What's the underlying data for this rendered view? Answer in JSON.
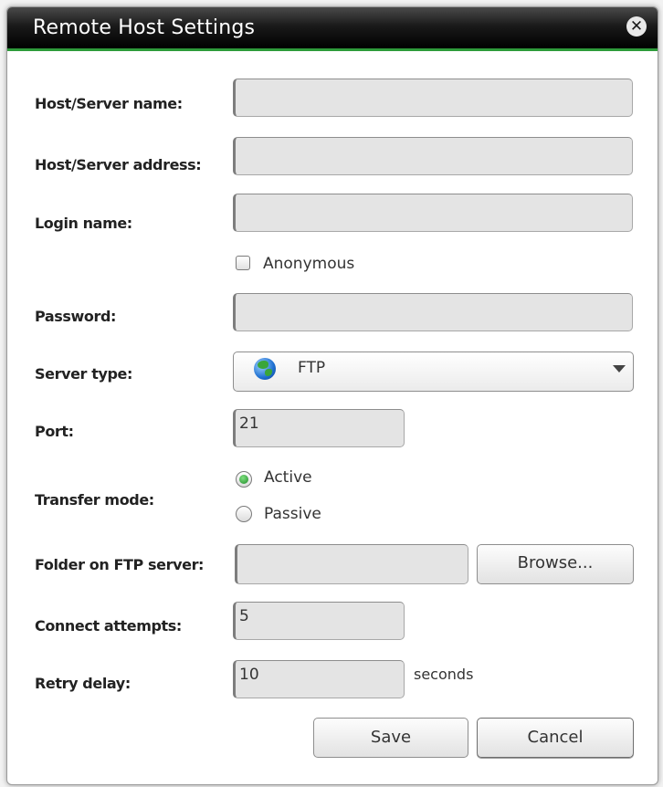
{
  "window": {
    "title": "Remote Host Settings",
    "close_icon": "close-icon"
  },
  "fields": {
    "host_name": {
      "label": "Host/Server name:",
      "value": ""
    },
    "host_address": {
      "label": "Host/Server address:",
      "value": ""
    },
    "login_name": {
      "label": "Login name:",
      "value": ""
    },
    "anonymous": {
      "label": "Anonymous",
      "checked": false
    },
    "password": {
      "label": "Password:",
      "value": ""
    },
    "server_type": {
      "label": "Server type:",
      "selected": "FTP",
      "icon": "globe-icon"
    },
    "port": {
      "label": "Port:",
      "value": "21"
    },
    "transfer_mode": {
      "label": "Transfer mode:",
      "options": [
        {
          "label": "Active",
          "selected": true
        },
        {
          "label": "Passive",
          "selected": false
        }
      ]
    },
    "folder": {
      "label": "Folder on FTP server:",
      "value": "",
      "browse_label": "Browse..."
    },
    "connect_attempts": {
      "label": "Connect attempts:",
      "value": "5"
    },
    "retry_delay": {
      "label": "Retry delay:",
      "value": "10",
      "suffix": "seconds"
    }
  },
  "actions": {
    "save_label": "Save",
    "cancel_label": "Cancel"
  },
  "colors": {
    "accent": "#2e9b3a",
    "titlebar": "#000000"
  }
}
